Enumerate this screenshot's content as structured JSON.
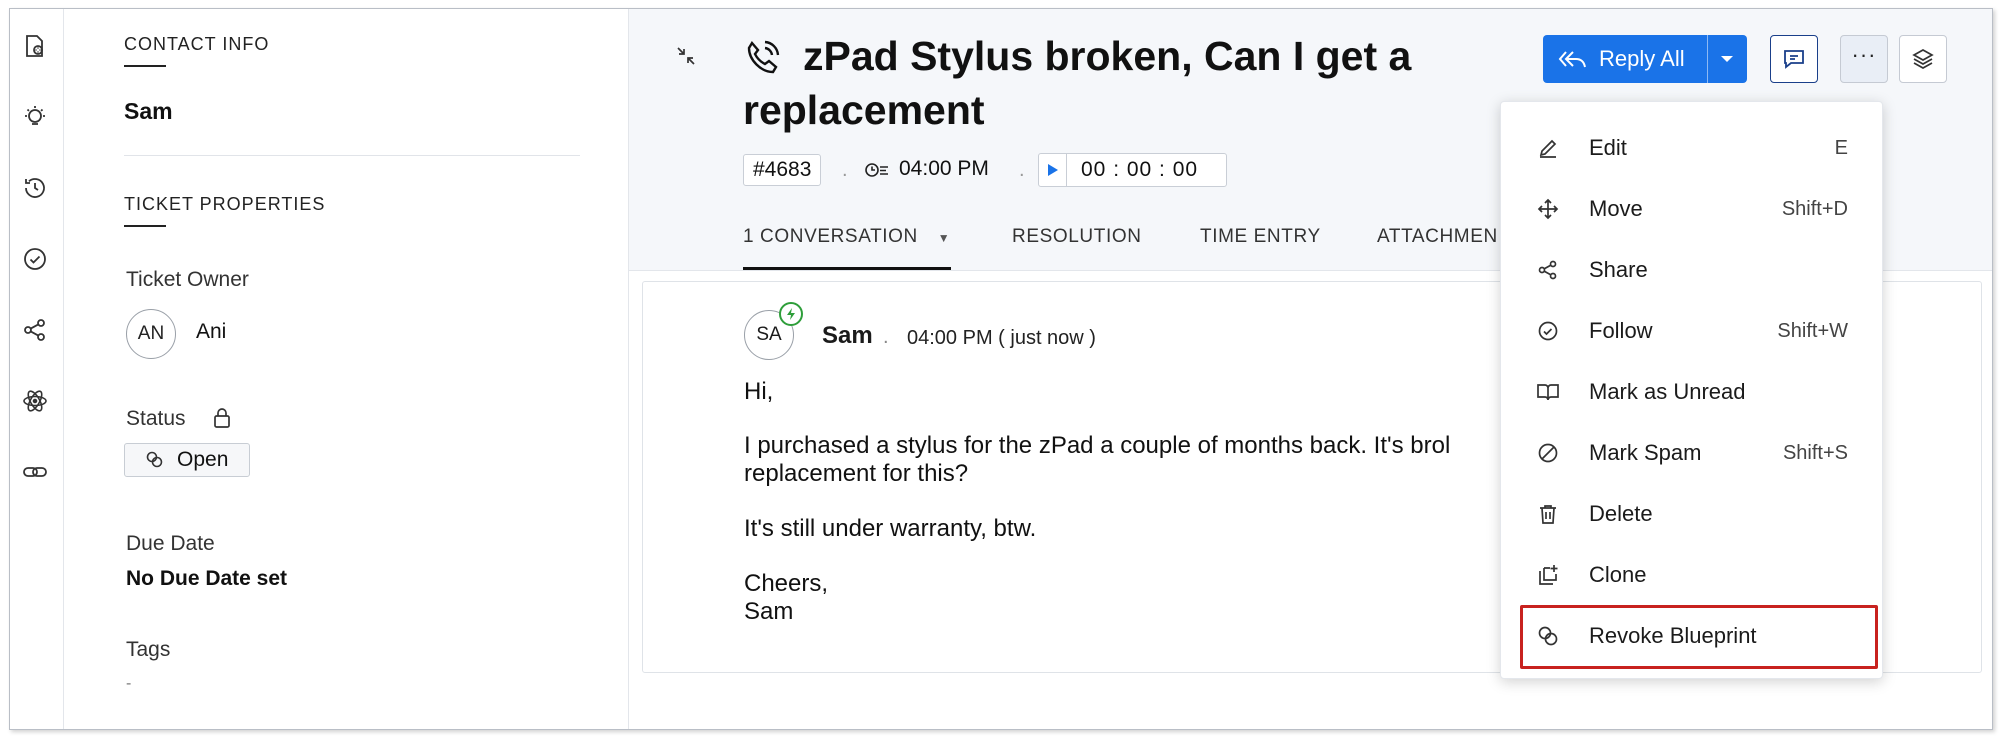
{
  "rail": {
    "icons": [
      "ticket-properties-icon",
      "bulb-icon",
      "history-icon",
      "check-circle-icon",
      "share-icon",
      "atom-icon",
      "link-icon"
    ]
  },
  "contact": {
    "section_title": "CONTACT INFO",
    "name": "Sam"
  },
  "ticket_properties": {
    "section_title": "TICKET PROPERTIES",
    "owner_label": "Ticket Owner",
    "owner_initials": "AN",
    "owner_name": "Ani",
    "status_label": "Status",
    "status_value": "Open",
    "due_label": "Due Date",
    "due_value": "No Due Date set",
    "tags_label": "Tags",
    "tags_value": "-"
  },
  "ticket": {
    "title": "zPad Stylus broken, Can I get a replacement",
    "id": "#4683",
    "time": "04:00 PM",
    "timer": "00 : 00 : 00"
  },
  "tabs": [
    {
      "label": "1 CONVERSATION"
    },
    {
      "label": "RESOLUTION"
    },
    {
      "label": "TIME ENTRY"
    },
    {
      "label": "ATTACHMEN"
    }
  ],
  "toolbar": {
    "reply_all_label": "Reply All"
  },
  "message": {
    "avatar_initials": "SA",
    "author": "Sam",
    "sep": ".",
    "timestamp": "04:00 PM ( just now )",
    "lines": [
      "Hi,",
      "I purchased a stylus for the zPad a couple of months back. It's brol",
      "replacement for this?",
      "It's still under warranty, btw.",
      "Cheers,",
      "Sam"
    ]
  },
  "menu": {
    "items": [
      {
        "label": "Edit",
        "shortcut": "E",
        "icon": "edit-icon"
      },
      {
        "label": "Move",
        "shortcut": "Shift+D",
        "icon": "move-icon"
      },
      {
        "label": "Share",
        "shortcut": "",
        "icon": "share-icon"
      },
      {
        "label": "Follow",
        "shortcut": "Shift+W",
        "icon": "follow-icon"
      },
      {
        "label": "Mark as Unread",
        "shortcut": "",
        "icon": "book-icon"
      },
      {
        "label": "Mark Spam",
        "shortcut": "Shift+S",
        "icon": "spam-icon"
      },
      {
        "label": "Delete",
        "shortcut": "",
        "icon": "trash-icon"
      },
      {
        "label": "Clone",
        "shortcut": "",
        "icon": "clone-icon"
      },
      {
        "label": "Revoke Blueprint",
        "shortcut": "",
        "icon": "blueprint-icon"
      }
    ]
  },
  "colors": {
    "accent": "#1a73e8",
    "highlight": "#c8221f",
    "status_ok": "#2e9e3a"
  }
}
